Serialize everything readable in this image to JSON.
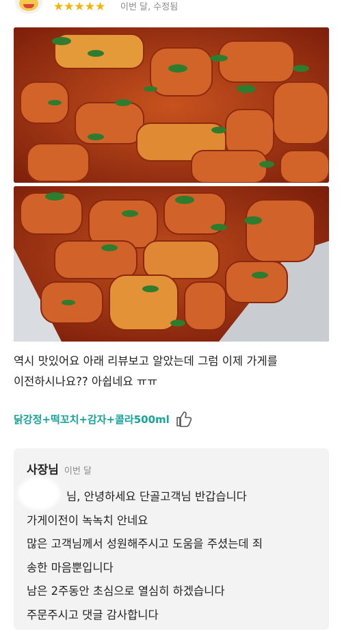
{
  "review": {
    "rating_stars": "★★★★★",
    "meta": "이번 달, 수정됨",
    "text_lines": [
      "역시 맛있어요 아래 리뷰보고 알았는데 그럼 이제 가게를",
      "이전하시나요?? 아쉽네요 ㅠㅠ"
    ],
    "menu": "닭강정+떡꼬치+감자+콜라500ml"
  },
  "reply": {
    "owner": "사장님",
    "date": "이번 달",
    "lines": [
      "님, 안녕하세요 단골고객님 반갑습니다",
      "가게이전이 녹녹치 안네요",
      "많은 고객님께서 성원해주시고 도움을 주셨는데 죄",
      "송한 마음뿐입니다",
      "남은 2주동안 초심으로 열심히 하겠습니다",
      "주문주시고 댓글 감사합니다"
    ]
  },
  "icons": {
    "avatar": "user-avatar-icon",
    "rating": "star-icon",
    "like": "thumbs-up-icon"
  },
  "colors": {
    "star": "#f5b400",
    "menu_accent": "#16a39a",
    "reply_background": "#f3f3f3"
  }
}
